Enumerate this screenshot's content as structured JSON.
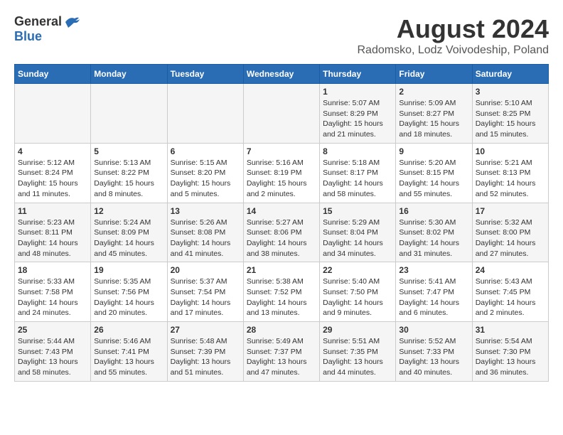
{
  "header": {
    "logo_general": "General",
    "logo_blue": "Blue",
    "month_year": "August 2024",
    "location": "Radomsko, Lodz Voivodeship, Poland"
  },
  "weekdays": [
    "Sunday",
    "Monday",
    "Tuesday",
    "Wednesday",
    "Thursday",
    "Friday",
    "Saturday"
  ],
  "weeks": [
    [
      {
        "day": "",
        "info": ""
      },
      {
        "day": "",
        "info": ""
      },
      {
        "day": "",
        "info": ""
      },
      {
        "day": "",
        "info": ""
      },
      {
        "day": "1",
        "info": "Sunrise: 5:07 AM\nSunset: 8:29 PM\nDaylight: 15 hours\nand 21 minutes."
      },
      {
        "day": "2",
        "info": "Sunrise: 5:09 AM\nSunset: 8:27 PM\nDaylight: 15 hours\nand 18 minutes."
      },
      {
        "day": "3",
        "info": "Sunrise: 5:10 AM\nSunset: 8:25 PM\nDaylight: 15 hours\nand 15 minutes."
      }
    ],
    [
      {
        "day": "4",
        "info": "Sunrise: 5:12 AM\nSunset: 8:24 PM\nDaylight: 15 hours\nand 11 minutes."
      },
      {
        "day": "5",
        "info": "Sunrise: 5:13 AM\nSunset: 8:22 PM\nDaylight: 15 hours\nand 8 minutes."
      },
      {
        "day": "6",
        "info": "Sunrise: 5:15 AM\nSunset: 8:20 PM\nDaylight: 15 hours\nand 5 minutes."
      },
      {
        "day": "7",
        "info": "Sunrise: 5:16 AM\nSunset: 8:19 PM\nDaylight: 15 hours\nand 2 minutes."
      },
      {
        "day": "8",
        "info": "Sunrise: 5:18 AM\nSunset: 8:17 PM\nDaylight: 14 hours\nand 58 minutes."
      },
      {
        "day": "9",
        "info": "Sunrise: 5:20 AM\nSunset: 8:15 PM\nDaylight: 14 hours\nand 55 minutes."
      },
      {
        "day": "10",
        "info": "Sunrise: 5:21 AM\nSunset: 8:13 PM\nDaylight: 14 hours\nand 52 minutes."
      }
    ],
    [
      {
        "day": "11",
        "info": "Sunrise: 5:23 AM\nSunset: 8:11 PM\nDaylight: 14 hours\nand 48 minutes."
      },
      {
        "day": "12",
        "info": "Sunrise: 5:24 AM\nSunset: 8:09 PM\nDaylight: 14 hours\nand 45 minutes."
      },
      {
        "day": "13",
        "info": "Sunrise: 5:26 AM\nSunset: 8:08 PM\nDaylight: 14 hours\nand 41 minutes."
      },
      {
        "day": "14",
        "info": "Sunrise: 5:27 AM\nSunset: 8:06 PM\nDaylight: 14 hours\nand 38 minutes."
      },
      {
        "day": "15",
        "info": "Sunrise: 5:29 AM\nSunset: 8:04 PM\nDaylight: 14 hours\nand 34 minutes."
      },
      {
        "day": "16",
        "info": "Sunrise: 5:30 AM\nSunset: 8:02 PM\nDaylight: 14 hours\nand 31 minutes."
      },
      {
        "day": "17",
        "info": "Sunrise: 5:32 AM\nSunset: 8:00 PM\nDaylight: 14 hours\nand 27 minutes."
      }
    ],
    [
      {
        "day": "18",
        "info": "Sunrise: 5:33 AM\nSunset: 7:58 PM\nDaylight: 14 hours\nand 24 minutes."
      },
      {
        "day": "19",
        "info": "Sunrise: 5:35 AM\nSunset: 7:56 PM\nDaylight: 14 hours\nand 20 minutes."
      },
      {
        "day": "20",
        "info": "Sunrise: 5:37 AM\nSunset: 7:54 PM\nDaylight: 14 hours\nand 17 minutes."
      },
      {
        "day": "21",
        "info": "Sunrise: 5:38 AM\nSunset: 7:52 PM\nDaylight: 14 hours\nand 13 minutes."
      },
      {
        "day": "22",
        "info": "Sunrise: 5:40 AM\nSunset: 7:50 PM\nDaylight: 14 hours\nand 9 minutes."
      },
      {
        "day": "23",
        "info": "Sunrise: 5:41 AM\nSunset: 7:47 PM\nDaylight: 14 hours\nand 6 minutes."
      },
      {
        "day": "24",
        "info": "Sunrise: 5:43 AM\nSunset: 7:45 PM\nDaylight: 14 hours\nand 2 minutes."
      }
    ],
    [
      {
        "day": "25",
        "info": "Sunrise: 5:44 AM\nSunset: 7:43 PM\nDaylight: 13 hours\nand 58 minutes."
      },
      {
        "day": "26",
        "info": "Sunrise: 5:46 AM\nSunset: 7:41 PM\nDaylight: 13 hours\nand 55 minutes."
      },
      {
        "day": "27",
        "info": "Sunrise: 5:48 AM\nSunset: 7:39 PM\nDaylight: 13 hours\nand 51 minutes."
      },
      {
        "day": "28",
        "info": "Sunrise: 5:49 AM\nSunset: 7:37 PM\nDaylight: 13 hours\nand 47 minutes."
      },
      {
        "day": "29",
        "info": "Sunrise: 5:51 AM\nSunset: 7:35 PM\nDaylight: 13 hours\nand 44 minutes."
      },
      {
        "day": "30",
        "info": "Sunrise: 5:52 AM\nSunset: 7:33 PM\nDaylight: 13 hours\nand 40 minutes."
      },
      {
        "day": "31",
        "info": "Sunrise: 5:54 AM\nSunset: 7:30 PM\nDaylight: 13 hours\nand 36 minutes."
      }
    ]
  ]
}
